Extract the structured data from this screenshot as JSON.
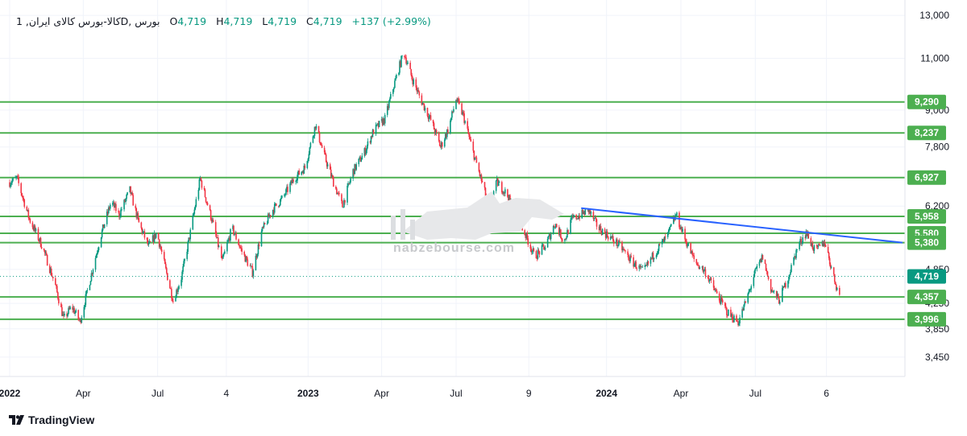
{
  "legend": {
    "symbol": "کالا-بورس کالای ایران, 1D, بورس",
    "open_label": "O",
    "open": "4,719",
    "high_label": "H",
    "high": "4,719",
    "low_label": "L",
    "low": "4,719",
    "close_label": "C",
    "close": "4,719",
    "change": "+137 (+2.99%)"
  },
  "branding": {
    "name": "TradingView",
    "watermark_url": "nabzebourse.com"
  },
  "colors": {
    "up": "#089981",
    "down": "#f23645",
    "levels": "#4caf50",
    "trendline": "#2962ff",
    "last_price": "#089981"
  },
  "chart_data": {
    "type": "candlestick",
    "y_scale": "log",
    "ylim": [
      3200,
      13800
    ],
    "y_ticks": [
      {
        "value": 13000,
        "label": "13,000"
      },
      {
        "value": 11000,
        "label": "11,000"
      },
      {
        "value": 9000,
        "label": "9,000"
      },
      {
        "value": 7800,
        "label": "7,800"
      },
      {
        "value": 6200,
        "label": "6,200"
      },
      {
        "value": 4850,
        "label": "4,850"
      },
      {
        "value": 4250,
        "label": "4,250"
      },
      {
        "value": 3850,
        "label": "3,850"
      },
      {
        "value": 3450,
        "label": "3,450"
      }
    ],
    "x_range": [
      "2022-01-01",
      "2024-12-31"
    ],
    "x_ticks": [
      {
        "date": "2022-01-01",
        "label": "2022"
      },
      {
        "date": "2022-04-01",
        "label": "Apr"
      },
      {
        "date": "2022-07-01",
        "label": "Jul"
      },
      {
        "date": "2022-09-23",
        "label": "4"
      },
      {
        "date": "2023-01-01",
        "label": "2023"
      },
      {
        "date": "2023-04-01",
        "label": "Apr"
      },
      {
        "date": "2023-07-01",
        "label": "Jul"
      },
      {
        "date": "2023-09-28",
        "label": "9"
      },
      {
        "date": "2024-01-01",
        "label": "2024"
      },
      {
        "date": "2024-04-01",
        "label": "Apr"
      },
      {
        "date": "2024-07-01",
        "label": "Jul"
      },
      {
        "date": "2024-09-26",
        "label": "6"
      }
    ],
    "path": [
      [
        "2022-01-01",
        6800
      ],
      [
        "2022-01-10",
        6900
      ],
      [
        "2022-01-25",
        5900
      ],
      [
        "2022-02-10",
        5300
      ],
      [
        "2022-02-25",
        4600
      ],
      [
        "2022-03-08",
        4000
      ],
      [
        "2022-03-18",
        4200
      ],
      [
        "2022-03-28",
        3960
      ],
      [
        "2022-04-10",
        4700
      ],
      [
        "2022-04-22",
        5500
      ],
      [
        "2022-05-05",
        6300
      ],
      [
        "2022-05-15",
        6000
      ],
      [
        "2022-05-28",
        6600
      ],
      [
        "2022-06-08",
        5800
      ],
      [
        "2022-06-20",
        5300
      ],
      [
        "2022-06-30",
        5600
      ],
      [
        "2022-07-10",
        4900
      ],
      [
        "2022-07-20",
        4300
      ],
      [
        "2022-07-30",
        4700
      ],
      [
        "2022-08-10",
        5600
      ],
      [
        "2022-08-22",
        6900
      ],
      [
        "2022-09-05",
        5900
      ],
      [
        "2022-09-18",
        5000
      ],
      [
        "2022-09-30",
        5700
      ],
      [
        "2022-10-12",
        5200
      ],
      [
        "2022-10-25",
        4800
      ],
      [
        "2022-11-05",
        5600
      ],
      [
        "2022-11-18",
        6100
      ],
      [
        "2022-12-01",
        6400
      ],
      [
        "2022-12-15",
        6900
      ],
      [
        "2022-12-28",
        7200
      ],
      [
        "2023-01-10",
        8500
      ],
      [
        "2023-01-20",
        7600
      ],
      [
        "2023-02-01",
        6800
      ],
      [
        "2023-02-12",
        6200
      ],
      [
        "2023-02-25",
        7100
      ],
      [
        "2023-03-10",
        7600
      ],
      [
        "2023-03-22",
        8300
      ],
      [
        "2023-04-05",
        8700
      ],
      [
        "2023-04-15",
        9800
      ],
      [
        "2023-04-28",
        11300
      ],
      [
        "2023-05-08",
        10200
      ],
      [
        "2023-05-20",
        9300
      ],
      [
        "2023-06-01",
        8600
      ],
      [
        "2023-06-12",
        7800
      ],
      [
        "2023-06-22",
        8400
      ],
      [
        "2023-07-01",
        9400
      ],
      [
        "2023-07-10",
        8800
      ],
      [
        "2023-07-20",
        7800
      ],
      [
        "2023-07-30",
        7000
      ],
      [
        "2023-08-10",
        6200
      ],
      [
        "2023-08-20",
        6800
      ],
      [
        "2023-09-01",
        6500
      ],
      [
        "2023-09-12",
        6000
      ],
      [
        "2023-09-25",
        5500
      ],
      [
        "2023-10-05",
        5100
      ],
      [
        "2023-10-18",
        5300
      ],
      [
        "2023-10-30",
        5800
      ],
      [
        "2023-11-10",
        5400
      ],
      [
        "2023-11-20",
        5900
      ],
      [
        "2023-12-01",
        6000
      ],
      [
        "2023-12-10",
        6100
      ],
      [
        "2023-12-22",
        5700
      ],
      [
        "2024-01-05",
        5500
      ],
      [
        "2024-01-18",
        5300
      ],
      [
        "2024-02-01",
        5000
      ],
      [
        "2024-02-15",
        4800
      ],
      [
        "2024-03-01",
        5200
      ],
      [
        "2024-03-15",
        5500
      ],
      [
        "2024-03-26",
        6000
      ],
      [
        "2024-04-05",
        5500
      ],
      [
        "2024-04-18",
        5000
      ],
      [
        "2024-05-01",
        4800
      ],
      [
        "2024-05-15",
        4400
      ],
      [
        "2024-05-28",
        4100
      ],
      [
        "2024-06-10",
        3950
      ],
      [
        "2024-06-20",
        4300
      ],
      [
        "2024-07-01",
        4800
      ],
      [
        "2024-07-10",
        5100
      ],
      [
        "2024-07-20",
        4500
      ],
      [
        "2024-07-30",
        4300
      ],
      [
        "2024-08-10",
        4700
      ],
      [
        "2024-08-22",
        5300
      ],
      [
        "2024-09-01",
        5600
      ],
      [
        "2024-09-12",
        5200
      ],
      [
        "2024-09-24",
        5400
      ],
      [
        "2024-10-05",
        4700
      ],
      [
        "2024-10-12",
        4370
      ]
    ],
    "horizontal_levels": [
      {
        "value": 9290,
        "label": "9,290"
      },
      {
        "value": 8237,
        "label": "8,237"
      },
      {
        "value": 6927,
        "label": "6,927"
      },
      {
        "value": 5958,
        "label": "5,958"
      },
      {
        "value": 5580,
        "label": "5,580"
      },
      {
        "value": 5380,
        "label": "5,380"
      },
      {
        "value": 4357,
        "label": "4,357"
      },
      {
        "value": 3996,
        "label": "3,996"
      }
    ],
    "trendline": {
      "start": [
        "2023-12-01",
        6150
      ],
      "end": [
        "2024-12-28",
        5380
      ]
    },
    "last_price": {
      "value": 4719,
      "label": "4,719"
    }
  }
}
